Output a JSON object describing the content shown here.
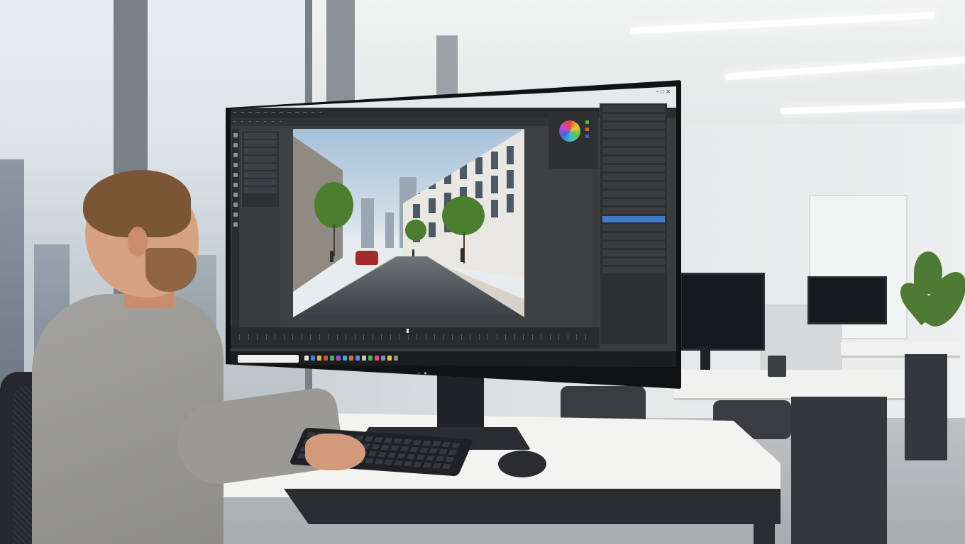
{
  "scene": {
    "colors": {
      "screen_bg": "#3a3b3d",
      "selected_layer": "#3f7bc9",
      "sweater": "#9a9996",
      "car": "#a32b2b"
    }
  },
  "screen": {
    "window_controls": "−  □  ✕",
    "menu_items": [
      "",
      "",
      "",
      "",
      "",
      "",
      "",
      "",
      "",
      "",
      "",
      ""
    ],
    "options_items": [
      "",
      "",
      "",
      "",
      "",
      "",
      ""
    ],
    "layers_mini": [
      "",
      "",
      "",
      "",
      "",
      "",
      "",
      ""
    ],
    "layers_panel": [
      "",
      "",
      "",
      "",
      "",
      "",
      "",
      "",
      "",
      "",
      "",
      "",
      "",
      "",
      "",
      "",
      "",
      "",
      "",
      ""
    ],
    "taskbar_time": "",
    "icons": [
      "move-tool-icon",
      "marquee-tool-icon",
      "lasso-tool-icon",
      "crop-tool-icon",
      "brush-tool-icon",
      "eraser-tool-icon",
      "gradient-tool-icon",
      "text-tool-icon",
      "hand-tool-icon",
      "zoom-tool-icon"
    ]
  }
}
